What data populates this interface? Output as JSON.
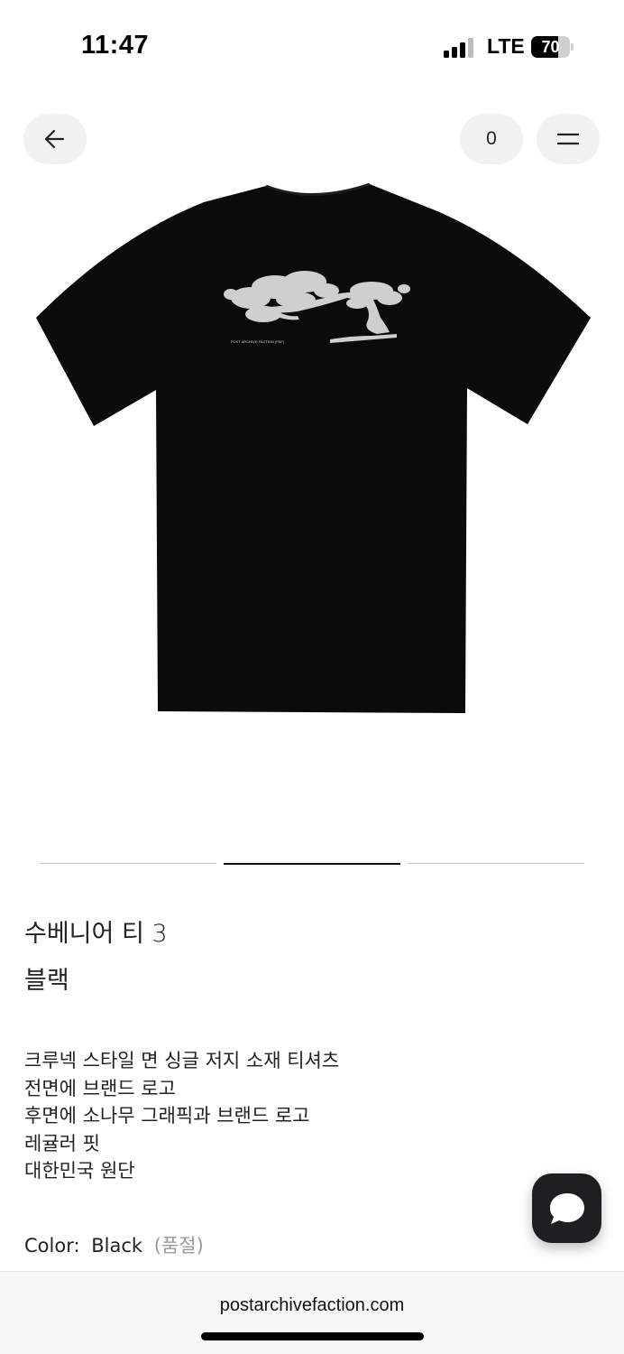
{
  "status_bar": {
    "time": "11:47",
    "network": "LTE",
    "battery_percent": "70",
    "battery_level": 0.7
  },
  "nav": {
    "back_icon": "arrow-left-icon",
    "cart_count": "0",
    "menu_icon": "hamburger-menu-icon"
  },
  "product": {
    "image_alt": "black t-shirt back with pine tree graphic",
    "print_text": "POST ARCHIVE FACTION (PAF)",
    "carousel": {
      "total": 3,
      "active_index": 1
    },
    "name": "수베니어 티 3",
    "color_kr": "블랙",
    "description": [
      "크루넥 스타일 면 싱글 저지 소재 티셔츠",
      "전면에 브랜드 로고",
      "후면에 소나무 그래픽과 브랜드 로고",
      "레귤러 핏",
      "대한민국 원단"
    ],
    "color_label": "Color:",
    "color_value": "Black",
    "stock_status": "(품절)"
  },
  "chat": {
    "icon": "chat-bubble-icon"
  },
  "browser": {
    "url": "postarchivefaction.com"
  },
  "colors": {
    "shirt": "#0b0b0b",
    "graphic": "#cfcfcf",
    "nav_button_bg": "#f1f1f1",
    "chat_bg": "#1f1f21"
  }
}
